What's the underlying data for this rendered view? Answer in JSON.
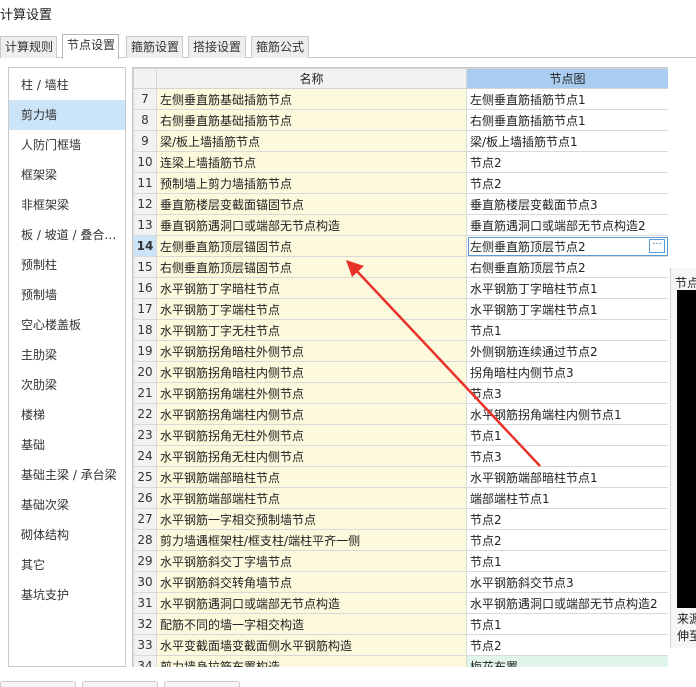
{
  "window": {
    "title": "计算设置"
  },
  "tabs": [
    "计算规则",
    "节点设置",
    "箍筋设置",
    "搭接设置",
    "箍筋公式"
  ],
  "active_tab": 1,
  "sidebar": {
    "items": [
      "柱 / 墙柱",
      "剪力墙",
      "人防门框墙",
      "框架梁",
      "非框架梁",
      "板 / 坡道 / 叠合…",
      "预制柱",
      "预制墙",
      "空心楼盖板",
      "主肋梁",
      "次肋梁",
      "楼梯",
      "基础",
      "基础主梁 / 承台梁",
      "基础次梁",
      "砌体结构",
      "其它",
      "基坑支护"
    ],
    "active_index": 1
  },
  "grid": {
    "headers": {
      "name": "名称",
      "node": "节点图"
    },
    "rows": [
      {
        "num": "7",
        "name": "左侧垂直筋基础插筋节点",
        "node": "左侧垂直筋插筋节点1"
      },
      {
        "num": "8",
        "name": "右侧垂直筋基础插筋节点",
        "node": "右侧垂直筋插筋节点1"
      },
      {
        "num": "9",
        "name": "梁/板上墙插筋节点",
        "node": "梁/板上墙插筋节点1"
      },
      {
        "num": "10",
        "name": "连梁上墙插筋节点",
        "node": "节点2"
      },
      {
        "num": "11",
        "name": "预制墙上剪力墙插筋节点",
        "node": "节点2"
      },
      {
        "num": "12",
        "name": "垂直筋楼层变截面锚固节点",
        "node": "垂直筋楼层变截面节点3"
      },
      {
        "num": "13",
        "name": "垂直钢筋遇洞口或端部无节点构造",
        "node": "垂直筋遇洞口或端部无节点构造2"
      },
      {
        "num": "14",
        "name": "左侧垂直筋顶层锚固节点",
        "node": "左侧垂直筋顶层节点2"
      },
      {
        "num": "15",
        "name": "右侧垂直筋顶层锚固节点",
        "node": "右侧垂直筋顶层节点2"
      },
      {
        "num": "16",
        "name": "水平钢筋丁字暗柱节点",
        "node": "水平钢筋丁字暗柱节点1"
      },
      {
        "num": "17",
        "name": "水平钢筋丁字端柱节点",
        "node": "水平钢筋丁字端柱节点1"
      },
      {
        "num": "18",
        "name": "水平钢筋丁字无柱节点",
        "node": "节点1"
      },
      {
        "num": "19",
        "name": "水平钢筋拐角暗柱外侧节点",
        "node": "外侧钢筋连续通过节点2"
      },
      {
        "num": "20",
        "name": "水平钢筋拐角暗柱内侧节点",
        "node": "拐角暗柱内侧节点3"
      },
      {
        "num": "21",
        "name": "水平钢筋拐角端柱外侧节点",
        "node": "节点3"
      },
      {
        "num": "22",
        "name": "水平钢筋拐角端柱内侧节点",
        "node": "水平钢筋拐角端柱内侧节点1"
      },
      {
        "num": "23",
        "name": "水平钢筋拐角无柱外侧节点",
        "node": "节点1"
      },
      {
        "num": "24",
        "name": "水平钢筋拐角无柱内侧节点",
        "node": "节点3"
      },
      {
        "num": "25",
        "name": "水平钢筋端部暗柱节点",
        "node": "水平钢筋端部暗柱节点1"
      },
      {
        "num": "26",
        "name": "水平钢筋端部端柱节点",
        "node": "端部端柱节点1"
      },
      {
        "num": "27",
        "name": "水平钢筋一字相交预制墙节点",
        "node": "节点2"
      },
      {
        "num": "28",
        "name": "剪力墙遇框架柱/框支柱/端柱平齐一侧",
        "node": "节点2"
      },
      {
        "num": "29",
        "name": "水平钢筋斜交丁字墙节点",
        "node": "节点1"
      },
      {
        "num": "30",
        "name": "水平钢筋斜交转角墙节点",
        "node": "水平钢筋斜交节点3"
      },
      {
        "num": "31",
        "name": "水平钢筋遇洞口或端部无节点构造",
        "node": "水平钢筋遇洞口或端部无节点构造2"
      },
      {
        "num": "32",
        "name": "配筋不同的墙一字相交构造",
        "node": "节点1"
      },
      {
        "num": "33",
        "name": "水平变截面墙变截面侧水平钢筋构造",
        "node": "节点2"
      },
      {
        "num": "34",
        "name": "剪力墙身拉筋布置构造",
        "node": "梅花布置"
      }
    ],
    "selected_row": "14",
    "editor_button": "···"
  },
  "preview": {
    "label": "节点",
    "note_line1": "来源",
    "note_line2": "伸至"
  },
  "colors": {
    "accent": "#a9cdf0",
    "row_highlight": "#cce4f7",
    "name_cell": "#fdf9dd",
    "annotation_arrow": "#e8332a"
  }
}
